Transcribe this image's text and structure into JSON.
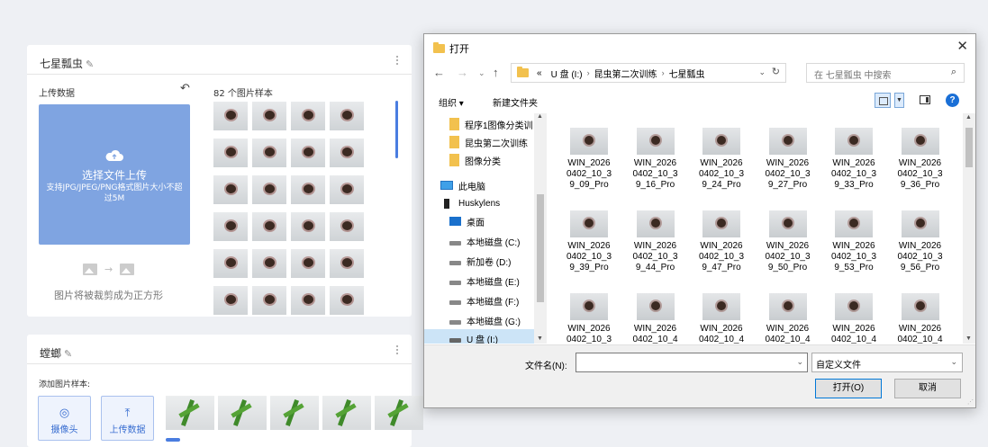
{
  "card1": {
    "title": "七星瓢虫",
    "upload_label": "上传数据",
    "upload_title": "选择文件上传",
    "upload_hint": "支持JPG/JPEG/PNG格式图片大小不超过5M",
    "crop_text": "图片将被裁剪成为正方形",
    "count_label": "82 个图片样本",
    "thumb_count": 24
  },
  "card2": {
    "title": "螳螂",
    "add_label": "添加图片样本:",
    "camera_label": "摄像头",
    "upload_label": "上传数据",
    "thumb_count": 5
  },
  "dialog": {
    "title": "打开",
    "address": {
      "prefix": "«",
      "crumbs": [
        "U 盘 (I:)",
        "昆虫第二次训练",
        "七星瓢虫"
      ]
    },
    "search_placeholder": "在 七星瓢虫 中搜索",
    "toolbar": {
      "organize": "组织 ▾",
      "new_folder": "新建文件夹"
    },
    "nav_items": [
      {
        "label": "程序1图像分类训",
        "icon": "folder"
      },
      {
        "label": "昆虫第二次训练",
        "icon": "folder"
      },
      {
        "label": "图像分类",
        "icon": "folder"
      },
      {
        "label": "此电脑",
        "icon": "pc"
      },
      {
        "label": "Huskylens",
        "icon": "phone"
      },
      {
        "label": "桌面",
        "icon": "desktop"
      },
      {
        "label": "本地磁盘 (C:)",
        "icon": "drive"
      },
      {
        "label": "新加卷 (D:)",
        "icon": "drive"
      },
      {
        "label": "本地磁盘 (E:)",
        "icon": "drive"
      },
      {
        "label": "本地磁盘 (F:)",
        "icon": "drive"
      },
      {
        "label": "本地磁盘 (G:)",
        "icon": "drive"
      },
      {
        "label": "U 盘 (I:)",
        "icon": "usb"
      }
    ],
    "files": [
      {
        "line1": "WIN_2026",
        "line2": "0402_10_3",
        "line3": "9_09_Pro"
      },
      {
        "line1": "WIN_2026",
        "line2": "0402_10_3",
        "line3": "9_16_Pro"
      },
      {
        "line1": "WIN_2026",
        "line2": "0402_10_3",
        "line3": "9_24_Pro"
      },
      {
        "line1": "WIN_2026",
        "line2": "0402_10_3",
        "line3": "9_27_Pro"
      },
      {
        "line1": "WIN_2026",
        "line2": "0402_10_3",
        "line3": "9_33_Pro"
      },
      {
        "line1": "WIN_2026",
        "line2": "0402_10_3",
        "line3": "9_36_Pro"
      },
      {
        "line1": "WIN_2026",
        "line2": "0402_10_3",
        "line3": "9_39_Pro"
      },
      {
        "line1": "WIN_2026",
        "line2": "0402_10_3",
        "line3": "9_44_Pro"
      },
      {
        "line1": "WIN_2026",
        "line2": "0402_10_3",
        "line3": "9_47_Pro"
      },
      {
        "line1": "WIN_2026",
        "line2": "0402_10_3",
        "line3": "9_50_Pro"
      },
      {
        "line1": "WIN_2026",
        "line2": "0402_10_3",
        "line3": "9_53_Pro"
      },
      {
        "line1": "WIN_2026",
        "line2": "0402_10_3",
        "line3": "9_56_Pro"
      },
      {
        "line1": "WIN_2026",
        "line2": "0402_10_3",
        "line3": ""
      },
      {
        "line1": "WIN_2026",
        "line2": "0402_10_4",
        "line3": ""
      },
      {
        "line1": "WIN_2026",
        "line2": "0402_10_4",
        "line3": ""
      },
      {
        "line1": "WIN_2026",
        "line2": "0402_10_4",
        "line3": ""
      },
      {
        "line1": "WIN_2026",
        "line2": "0402_10_4",
        "line3": ""
      },
      {
        "line1": "WIN_2026",
        "line2": "0402_10_4",
        "line3": ""
      }
    ],
    "filename_label": "文件名(N):",
    "filename_value": "",
    "filetype": "自定义文件",
    "open_button": "打开(O)",
    "cancel_button": "取消"
  },
  "colors": {
    "accent": "#4a7de0",
    "upload_box": "#7fa4e1",
    "dialog_selected": "#cce4f7"
  }
}
